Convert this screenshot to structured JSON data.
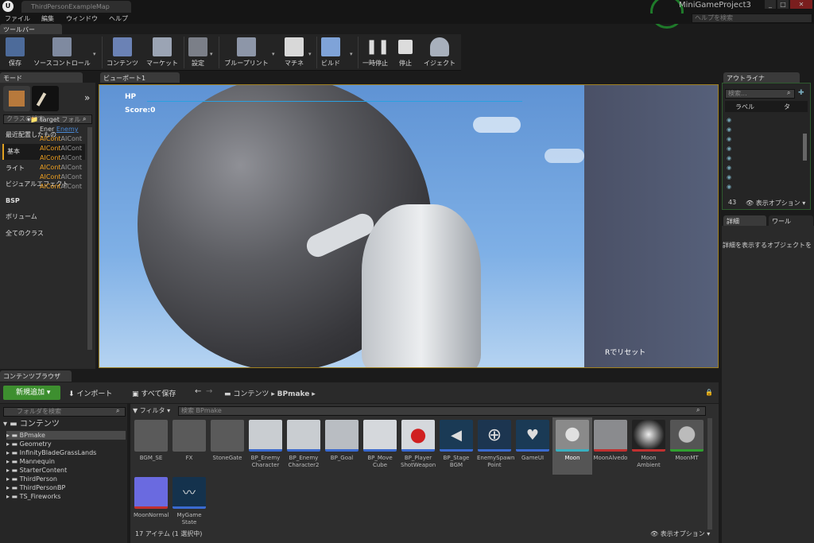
{
  "window": {
    "doc_tab": "ThirdPersonExampleMap",
    "project": "MiniGameProject3",
    "logo": "U"
  },
  "menu": [
    "ファイル",
    "編集",
    "ウィンドウ",
    "ヘルプ"
  ],
  "help_search_placeholder": "ヘルプを検索",
  "toolbar": {
    "tab": "ツールバー",
    "buttons": [
      "保存",
      "ソースコントロール",
      "コンテンツ",
      "マーケット",
      "設定",
      "ブループリント",
      "マチネ",
      "ビルド",
      "一時停止",
      "停止",
      "イジェクト"
    ]
  },
  "modes": {
    "tab": "モード",
    "search_placeholder": "クラスの検索",
    "items": [
      "最近配置したもの",
      "基本",
      "ライト",
      "ビジュアルエフェクト",
      "BSP",
      "ボリューム",
      "全てのクラス"
    ],
    "selected": "基本"
  },
  "viewport": {
    "tab": "ビューポート1",
    "hp": "HP",
    "score": "Score:0",
    "reset": "Rでリセット",
    "hp_fraction": 1.0
  },
  "outliner": {
    "tab": "アウトライナ",
    "search_placeholder": "検索...",
    "col_label": "ラベル",
    "col_type": "タ",
    "rows": [
      {
        "name": "target",
        "type": "フォル"
      },
      {
        "name": "Ener",
        "type": "Enemy"
      },
      {
        "name": "AICont",
        "type": "AICont"
      },
      {
        "name": "AICont",
        "type": "AICont"
      },
      {
        "name": "AICont",
        "type": "AICont"
      },
      {
        "name": "AICont",
        "type": "AICont"
      },
      {
        "name": "AICont",
        "type": "AICont"
      },
      {
        "name": "AICont",
        "type": "AICont"
      }
    ],
    "count": "43",
    "view_options": "表示オプション"
  },
  "details": {
    "tab1": "詳細",
    "tab2": "ワール",
    "hint": "詳細を表示するオブジェクトを"
  },
  "content_browser": {
    "tab": "コンテンツブラウザ",
    "add_new": "新規追加",
    "import": "インポート",
    "save_all": "すべて保存",
    "path": [
      "コンテンツ",
      "BPmake"
    ],
    "folder_search_placeholder": "フォルダを検索",
    "filter": "フィルタ",
    "asset_search_placeholder": "検索 BPmake",
    "root": "コンテンツ",
    "folders": [
      "BPmake",
      "Geometry",
      "InfinityBladeGrassLands",
      "Mannequin",
      "StarterContent",
      "ThirdPerson",
      "ThirdPersonBP",
      "TS_Fireworks"
    ],
    "assets": [
      {
        "name": "BGM_SE",
        "color": "#5a5a5a"
      },
      {
        "name": "FX",
        "color": "#5a5a5a"
      },
      {
        "name": "StoneGate",
        "color": "#5a5a5a"
      },
      {
        "name": "BP_Enemy Character",
        "color": "#c9cdd1"
      },
      {
        "name": "BP_Enemy Character2",
        "color": "#c9cdd1"
      },
      {
        "name": "BP_Goal",
        "color": "#b9bdc2"
      },
      {
        "name": "BP_Move Cube",
        "color": "#d5d8dc"
      },
      {
        "name": "BP_Player ShotWeapon",
        "color": "#d5d8dc"
      },
      {
        "name": "BP_Stage BGM",
        "color": "#1a3a55"
      },
      {
        "name": "EnemySpawn Point",
        "color": "#1c3550"
      },
      {
        "name": "GameUI",
        "color": "#1a3a55"
      },
      {
        "name": "Moon",
        "color": "#6f7074"
      },
      {
        "name": "MoonAlvedo",
        "color": "#8a8b8e"
      },
      {
        "name": "Moon Ambient",
        "color": "#444"
      },
      {
        "name": "MoonMT",
        "color": "#777"
      },
      {
        "name": "MoonNormal",
        "color": "#6a6ae0"
      },
      {
        "name": "MyGame State",
        "color": "#14324d"
      }
    ],
    "selected_asset": "Moon",
    "status": "17 アイテム (1 選択中)",
    "view_options": "表示オプション"
  }
}
